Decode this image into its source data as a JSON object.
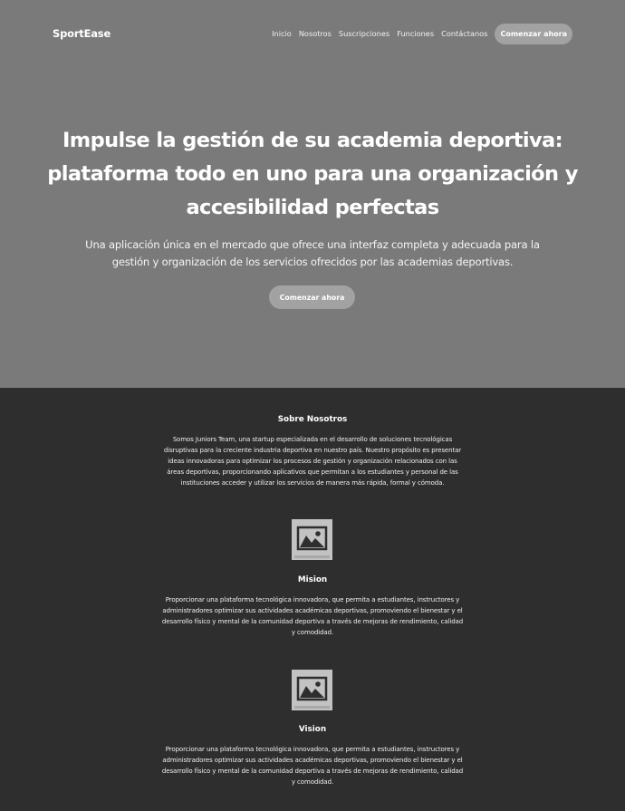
{
  "nav": {
    "brand": "SportEase",
    "links": [
      "Inicio",
      "Nosotros",
      "Suscripciones",
      "Funciones",
      "Contáctanos"
    ],
    "cta": "Comenzar ahora"
  },
  "hero": {
    "title_lines": [
      "Impulse la gestión de su academia deportiva:",
      "plataforma todo en uno para una organización y",
      "accesibilidad perfectas"
    ],
    "subtitle_lines": [
      "Una aplicación única en el mercado que ofrece una interfaz completa y adecuada para la",
      "gestión y organización de los servicios ofrecidos por las academias deportivas."
    ],
    "cta": "Comenzar ahora"
  },
  "about": {
    "title": "Sobre Nosotros",
    "text_lines": [
      "Somos Juniors Team, una startup especializada en el desarrollo de soluciones tecnológicas",
      "disruptivas para la creciente industria deportiva en nuestro país. Nuestro propósito es presentar",
      "ideas innovadoras para optimizar los procesos de gestión y organización relacionados con las",
      "áreas deportivas, proporcionando aplicativos que permitan a los estudiantes y personal de las",
      "instituciones acceder y utilizar los servicios de manera más rápida, formal y cómoda."
    ]
  },
  "mission": {
    "icon": "image-placeholder-icon",
    "title": "Mision",
    "text_lines": [
      "Proporcionar una plataforma tecnológica innovadora, que permita a estudiantes, instructores y",
      "administradores optimizar sus actividades académicas deportivas, promoviendo el bienestar y el",
      "desarrollo físico y mental de la comunidad deportiva a través de mejoras de rendimiento, calidad",
      "y comodidad."
    ]
  },
  "vision": {
    "icon": "image-placeholder-icon",
    "title": "Vision",
    "text_lines": [
      "Proporcionar una plataforma tecnológica innovadora, que permita a estudiantes, instructores y",
      "administradores optimizar sus actividades académicas deportivas, promoviendo el bienestar y el",
      "desarrollo físico y mental de la comunidad deportiva a través de mejoras de rendimiento, calidad",
      "y comodidad."
    ]
  },
  "colors": {
    "hero_bg": "#7a7a7a",
    "content_bg": "#2e2e2e",
    "button_bg": "#a2a2a2",
    "placeholder_bg": "#c2c2c2"
  }
}
